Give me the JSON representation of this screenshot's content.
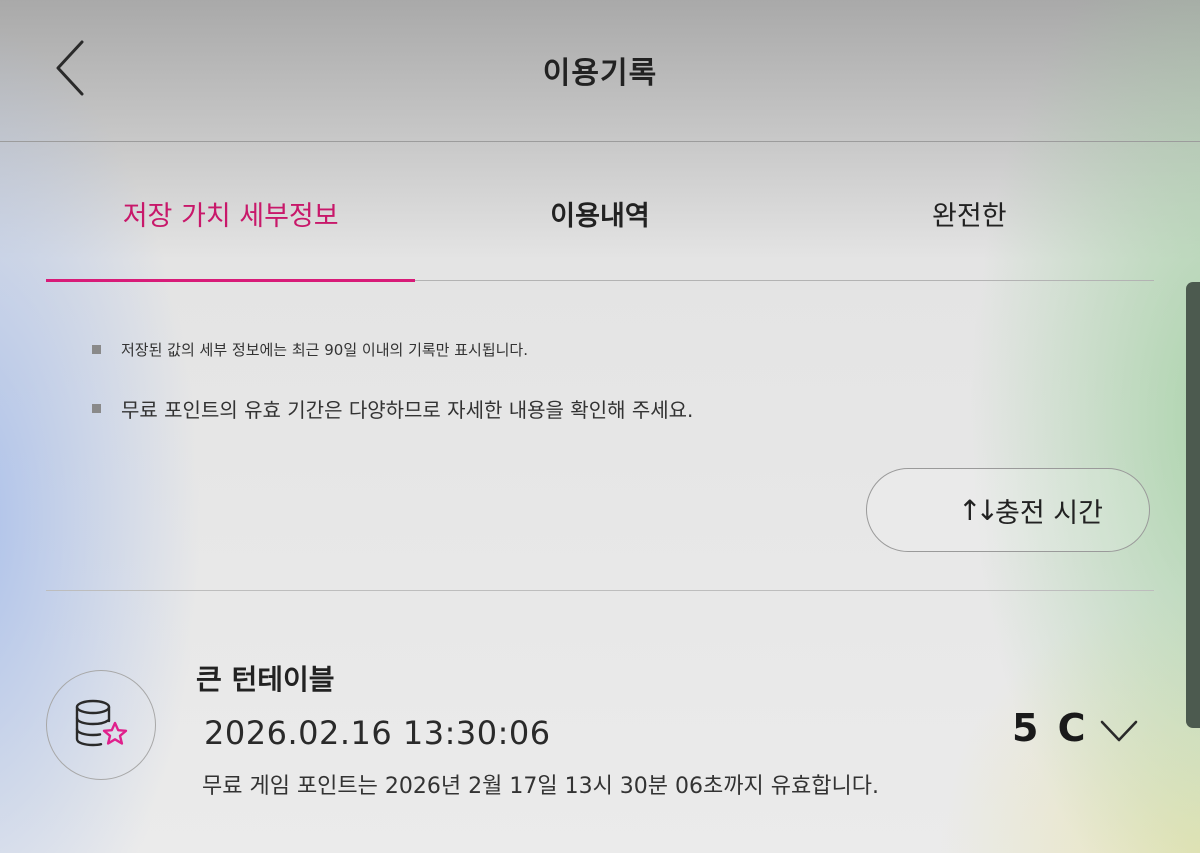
{
  "header": {
    "title": "이용기록",
    "back_icon": "chevron-left-icon"
  },
  "tabs": [
    {
      "label": "저장 가치 세부정보",
      "active": true
    },
    {
      "label": "이용내역",
      "active": false
    },
    {
      "label": "완전한",
      "active": false
    }
  ],
  "notes": [
    "저장된 값의 세부 정보에는 최근 90일 이내의 기록만 표시됩니다.",
    "무료 포인트의 유효 기간은 다양하므로 자세한 내용을 확인해 주세요."
  ],
  "sort": {
    "icon": "↑↓",
    "label": "충전 시간"
  },
  "records": [
    {
      "name": "큰 턴테이블",
      "datetime": "2026.02.16 13:30:06",
      "note": "무료 게임 포인트는 2026년 2월 17일 13시 30분 06초까지 유효합니다.",
      "amount": "5 C",
      "icon": "database-star-icon"
    }
  ],
  "colors": {
    "accent": "#d81b78",
    "star": "#e0208c"
  }
}
